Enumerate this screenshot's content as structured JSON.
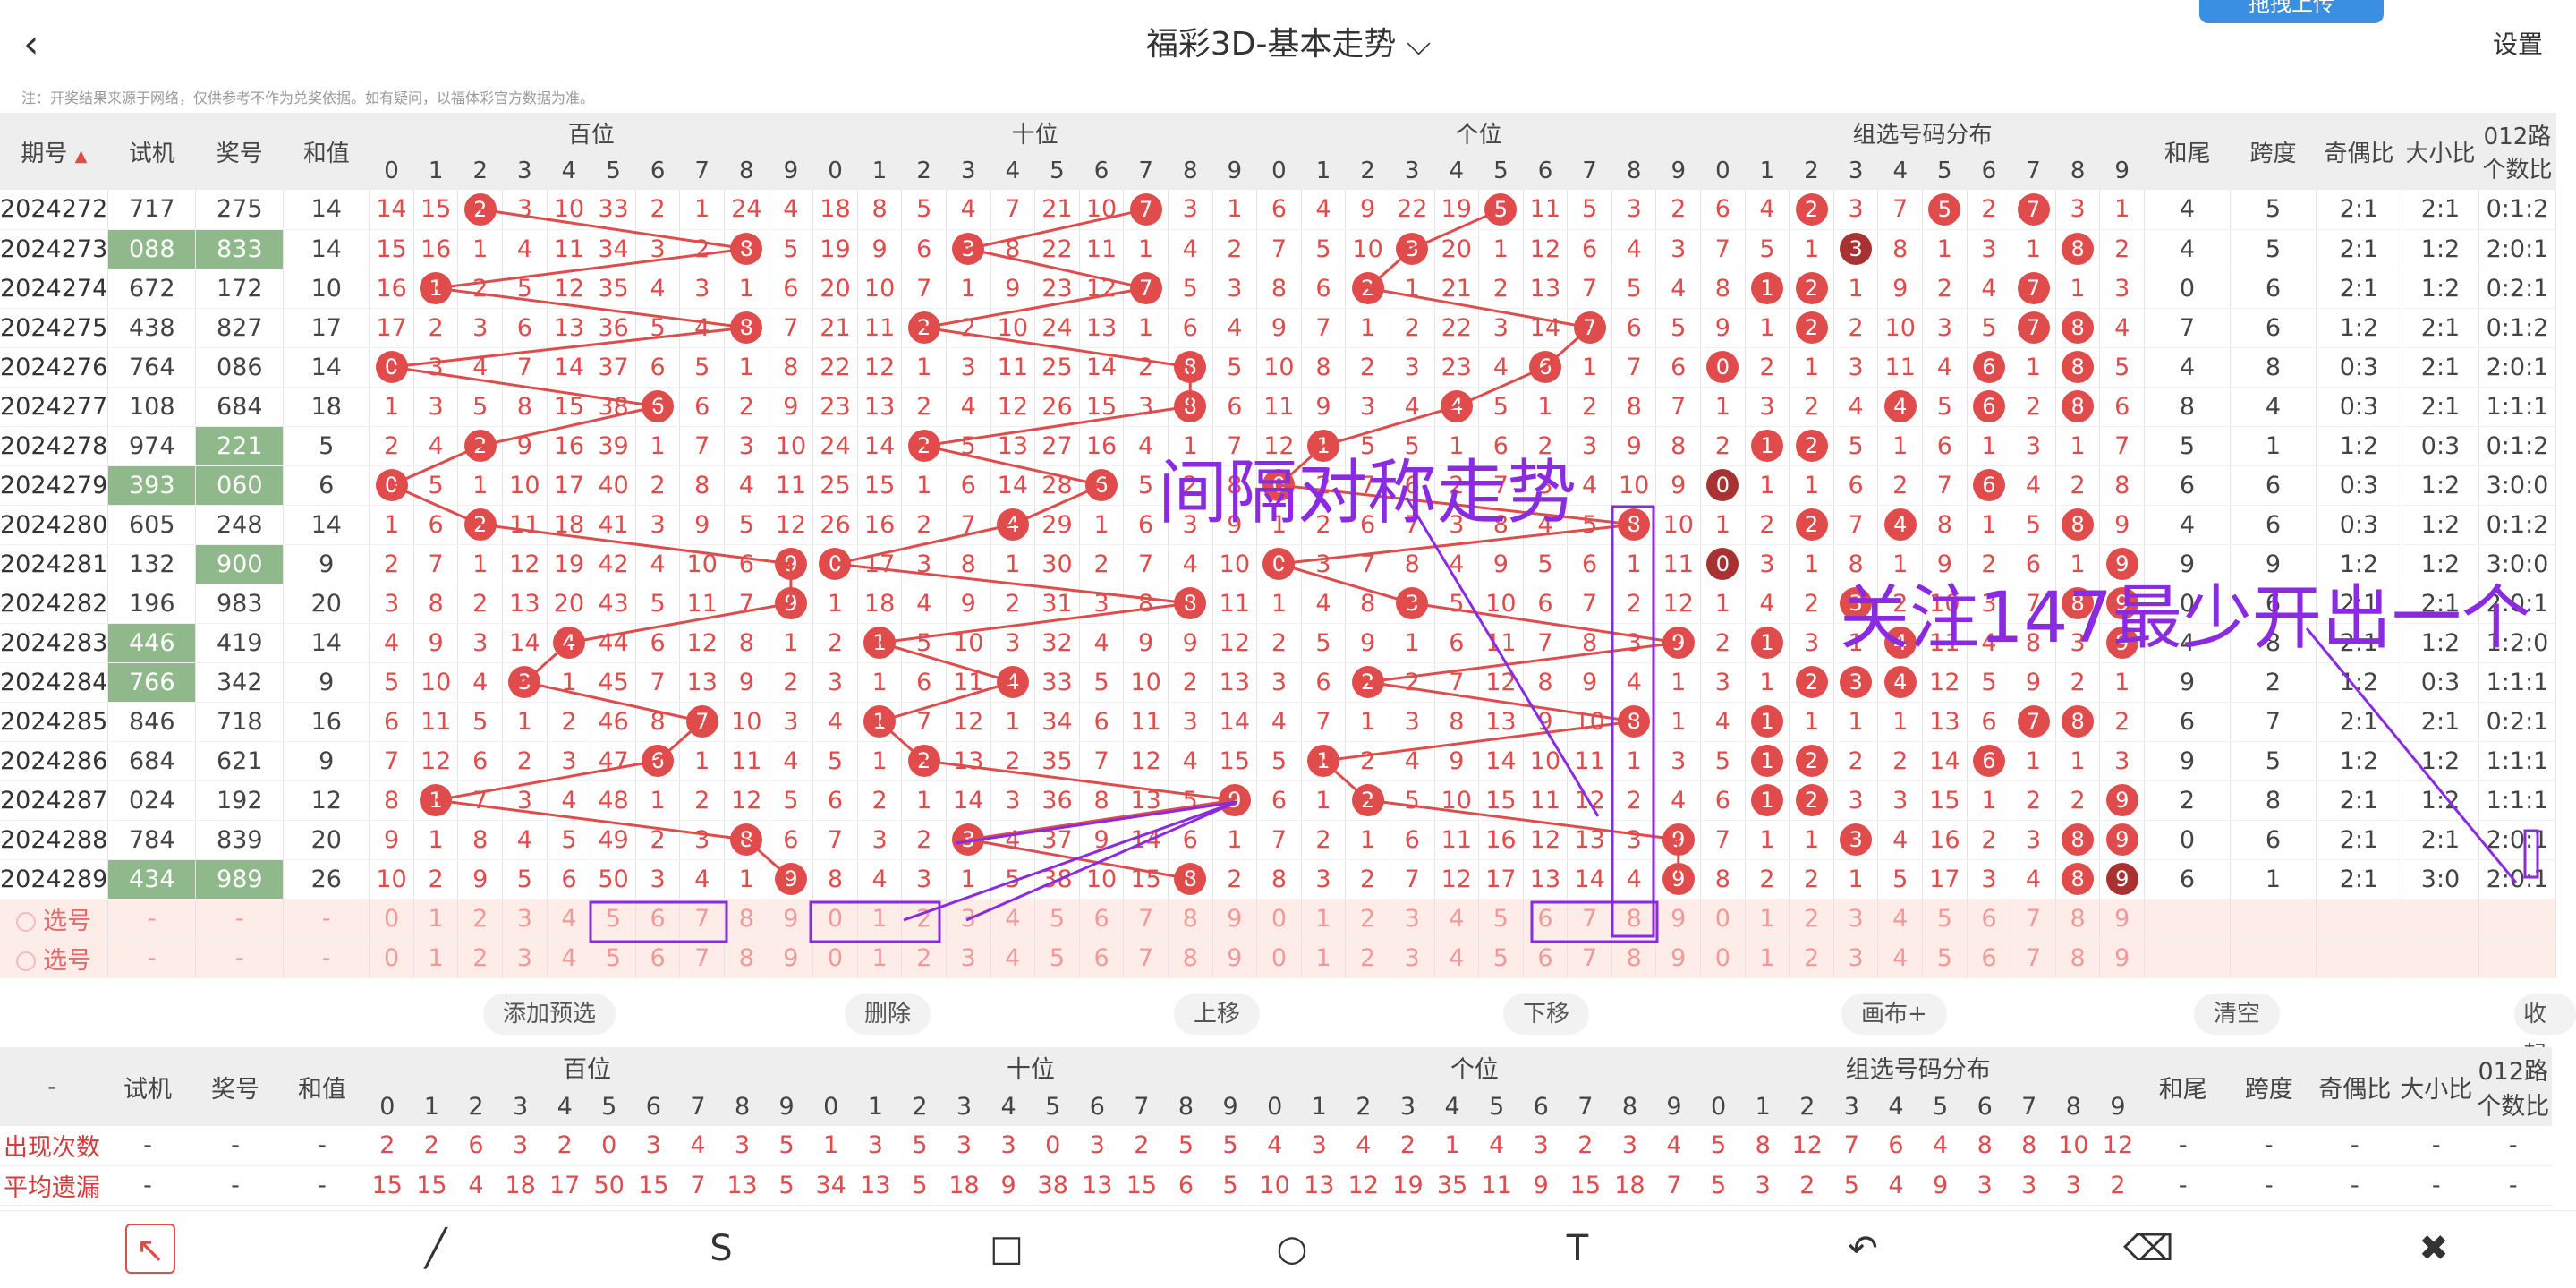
{
  "header": {
    "title": "福彩3D-基本走势",
    "settings": "设置",
    "upload": "拖拽上传"
  },
  "note": "注：开奖结果来源于网络，仅供参考不作为兑奖依据。如有疑问，以福体彩官方数据为准。",
  "columns": {
    "period": "期号",
    "test": "试机",
    "prize": "奖号",
    "sum": "和值",
    "hundreds": "百位",
    "tens": "十位",
    "units": "个位",
    "group": "组选号码分布",
    "sum_tail": "和尾",
    "span": "跨度",
    "odd_even": "奇偶比",
    "big_small": "大小比",
    "route012": "012路",
    "route012b": "个数比"
  },
  "digits": [
    "0",
    "1",
    "2",
    "3",
    "4",
    "5",
    "6",
    "7",
    "8",
    "9"
  ],
  "rows": [
    {
      "p": "2024272",
      "t": "717",
      "w": "275",
      "s": "14",
      "h": [
        "14",
        "15",
        "2",
        "3",
        "10",
        "33",
        "2",
        "1",
        "24",
        "4"
      ],
      "te": [
        "18",
        "8",
        "5",
        "4",
        "7",
        "21",
        "10",
        "7",
        "3",
        "1"
      ],
      "u": [
        "6",
        "4",
        "9",
        "22",
        "19",
        "5",
        "11",
        "5",
        "3",
        "2"
      ],
      "g": [
        "6",
        "4",
        "2",
        "3",
        "7",
        "5",
        "2",
        "7",
        "3",
        "1"
      ],
      "x": [
        "4",
        "5",
        "2:1",
        "2:1",
        "0:1:2"
      ]
    },
    {
      "p": "2024273",
      "t": "088",
      "w": "833",
      "s": "14",
      "h": [
        "15",
        "16",
        "1",
        "4",
        "11",
        "34",
        "3",
        "2",
        "8",
        "5"
      ],
      "te": [
        "19",
        "9",
        "6",
        "3",
        "8",
        "22",
        "11",
        "1",
        "4",
        "2"
      ],
      "u": [
        "7",
        "5",
        "10",
        "3",
        "20",
        "1",
        "12",
        "6",
        "4",
        "3"
      ],
      "g": [
        "7",
        "5",
        "1",
        "3",
        "8",
        "1",
        "3",
        "1",
        "8",
        "2"
      ],
      "x": [
        "4",
        "5",
        "2:1",
        "1:2",
        "2:0:1"
      ]
    },
    {
      "p": "2024274",
      "t": "672",
      "w": "172",
      "s": "10",
      "h": [
        "16",
        "1",
        "2",
        "5",
        "12",
        "35",
        "4",
        "3",
        "1",
        "6"
      ],
      "te": [
        "20",
        "10",
        "7",
        "1",
        "9",
        "23",
        "12",
        "7",
        "5",
        "3"
      ],
      "u": [
        "8",
        "6",
        "2",
        "1",
        "21",
        "2",
        "13",
        "7",
        "5",
        "4"
      ],
      "g": [
        "8",
        "1",
        "2",
        "1",
        "9",
        "2",
        "4",
        "7",
        "1",
        "3"
      ],
      "x": [
        "0",
        "6",
        "2:1",
        "1:2",
        "0:2:1"
      ]
    },
    {
      "p": "2024275",
      "t": "438",
      "w": "827",
      "s": "17",
      "h": [
        "17",
        "2",
        "3",
        "6",
        "13",
        "36",
        "5",
        "4",
        "8",
        "7"
      ],
      "te": [
        "21",
        "11",
        "2",
        "2",
        "10",
        "24",
        "13",
        "1",
        "6",
        "4"
      ],
      "u": [
        "9",
        "7",
        "1",
        "2",
        "22",
        "3",
        "14",
        "7",
        "6",
        "5"
      ],
      "g": [
        "9",
        "1",
        "2",
        "2",
        "10",
        "3",
        "5",
        "7",
        "8",
        "4"
      ],
      "x": [
        "7",
        "6",
        "1:2",
        "2:1",
        "0:1:2"
      ]
    },
    {
      "p": "2024276",
      "t": "764",
      "w": "086",
      "s": "14",
      "h": [
        "0",
        "3",
        "4",
        "7",
        "14",
        "37",
        "6",
        "5",
        "1",
        "8"
      ],
      "te": [
        "22",
        "12",
        "1",
        "3",
        "11",
        "25",
        "14",
        "2",
        "8",
        "5"
      ],
      "u": [
        "10",
        "8",
        "2",
        "3",
        "23",
        "4",
        "6",
        "1",
        "7",
        "6"
      ],
      "g": [
        "0",
        "2",
        "1",
        "3",
        "11",
        "4",
        "6",
        "1",
        "8",
        "5"
      ],
      "x": [
        "4",
        "8",
        "0:3",
        "2:1",
        "2:0:1"
      ]
    },
    {
      "p": "2024277",
      "t": "108",
      "w": "684",
      "s": "18",
      "h": [
        "1",
        "3",
        "5",
        "8",
        "15",
        "38",
        "6",
        "6",
        "2",
        "9"
      ],
      "te": [
        "23",
        "13",
        "2",
        "4",
        "12",
        "26",
        "15",
        "3",
        "8",
        "6"
      ],
      "u": [
        "11",
        "9",
        "3",
        "4",
        "4",
        "5",
        "1",
        "2",
        "8",
        "7"
      ],
      "g": [
        "1",
        "3",
        "2",
        "4",
        "4",
        "5",
        "6",
        "2",
        "8",
        "6"
      ],
      "x": [
        "8",
        "4",
        "0:3",
        "2:1",
        "1:1:1"
      ]
    },
    {
      "p": "2024278",
      "t": "974",
      "w": "221",
      "s": "5",
      "h": [
        "2",
        "4",
        "2",
        "9",
        "16",
        "39",
        "1",
        "7",
        "3",
        "10"
      ],
      "te": [
        "24",
        "14",
        "2",
        "5",
        "13",
        "27",
        "16",
        "4",
        "1",
        "7"
      ],
      "u": [
        "12",
        "1",
        "5",
        "5",
        "1",
        "6",
        "2",
        "3",
        "9",
        "8"
      ],
      "g": [
        "2",
        "1",
        "2",
        "5",
        "1",
        "6",
        "1",
        "3",
        "1",
        "7"
      ],
      "x": [
        "5",
        "1",
        "1:2",
        "0:3",
        "0:1:2"
      ]
    },
    {
      "p": "2024279",
      "t": "393",
      "w": "060",
      "s": "6",
      "h": [
        "0",
        "5",
        "1",
        "10",
        "17",
        "40",
        "2",
        "8",
        "4",
        "11"
      ],
      "te": [
        "25",
        "15",
        "1",
        "6",
        "14",
        "28",
        "6",
        "5",
        "2",
        "8"
      ],
      "u": [
        "0",
        "2",
        "7",
        "6",
        "2",
        "7",
        "3",
        "4",
        "10",
        "9"
      ],
      "g": [
        "0",
        "1",
        "1",
        "6",
        "2",
        "7",
        "6",
        "4",
        "2",
        "8"
      ],
      "x": [
        "6",
        "6",
        "0:3",
        "1:2",
        "3:0:0"
      ]
    },
    {
      "p": "2024280",
      "t": "605",
      "w": "248",
      "s": "14",
      "h": [
        "1",
        "6",
        "2",
        "11",
        "18",
        "41",
        "3",
        "9",
        "5",
        "12"
      ],
      "te": [
        "26",
        "16",
        "2",
        "7",
        "4",
        "29",
        "1",
        "6",
        "3",
        "9"
      ],
      "u": [
        "1",
        "2",
        "6",
        "7",
        "3",
        "8",
        "4",
        "5",
        "8",
        "10"
      ],
      "g": [
        "1",
        "2",
        "2",
        "7",
        "4",
        "8",
        "1",
        "5",
        "8",
        "9"
      ],
      "x": [
        "4",
        "6",
        "0:3",
        "1:2",
        "0:1:2"
      ]
    },
    {
      "p": "2024281",
      "t": "132",
      "w": "900",
      "s": "9",
      "h": [
        "2",
        "7",
        "1",
        "12",
        "19",
        "42",
        "4",
        "10",
        "6",
        "9"
      ],
      "te": [
        "0",
        "17",
        "3",
        "8",
        "1",
        "30",
        "2",
        "7",
        "4",
        "10"
      ],
      "u": [
        "0",
        "3",
        "7",
        "8",
        "4",
        "9",
        "5",
        "6",
        "1",
        "11"
      ],
      "g": [
        "0",
        "3",
        "1",
        "8",
        "1",
        "9",
        "2",
        "6",
        "1",
        "9"
      ],
      "x": [
        "9",
        "9",
        "1:2",
        "1:2",
        "3:0:0"
      ]
    },
    {
      "p": "2024282",
      "t": "196",
      "w": "983",
      "s": "20",
      "h": [
        "3",
        "8",
        "2",
        "13",
        "20",
        "43",
        "5",
        "11",
        "7",
        "9"
      ],
      "te": [
        "1",
        "18",
        "4",
        "9",
        "2",
        "31",
        "3",
        "8",
        "8",
        "11"
      ],
      "u": [
        "1",
        "4",
        "8",
        "3",
        "5",
        "10",
        "6",
        "7",
        "2",
        "12"
      ],
      "g": [
        "1",
        "4",
        "2",
        "3",
        "2",
        "10",
        "3",
        "7",
        "8",
        "9"
      ],
      "x": [
        "0",
        "6",
        "2:1",
        "2:1",
        "2:0:1"
      ]
    },
    {
      "p": "2024283",
      "t": "446",
      "w": "419",
      "s": "14",
      "h": [
        "4",
        "9",
        "3",
        "14",
        "4",
        "44",
        "6",
        "12",
        "8",
        "1"
      ],
      "te": [
        "2",
        "1",
        "5",
        "10",
        "3",
        "32",
        "4",
        "9",
        "9",
        "12"
      ],
      "u": [
        "2",
        "5",
        "9",
        "1",
        "6",
        "11",
        "7",
        "8",
        "3",
        "9"
      ],
      "g": [
        "2",
        "1",
        "3",
        "1",
        "4",
        "11",
        "4",
        "8",
        "3",
        "9"
      ],
      "x": [
        "4",
        "8",
        "2:1",
        "1:2",
        "1:2:0"
      ]
    },
    {
      "p": "2024284",
      "t": "766",
      "w": "342",
      "s": "9",
      "h": [
        "5",
        "10",
        "4",
        "3",
        "1",
        "45",
        "7",
        "13",
        "9",
        "2"
      ],
      "te": [
        "3",
        "1",
        "6",
        "11",
        "4",
        "33",
        "5",
        "10",
        "2",
        "13"
      ],
      "u": [
        "3",
        "6",
        "2",
        "2",
        "7",
        "12",
        "8",
        "9",
        "4",
        "1"
      ],
      "g": [
        "3",
        "1",
        "2",
        "3",
        "4",
        "12",
        "5",
        "9",
        "2",
        "1"
      ],
      "x": [
        "9",
        "2",
        "1:2",
        "0:3",
        "1:1:1"
      ]
    },
    {
      "p": "2024285",
      "t": "846",
      "w": "718",
      "s": "16",
      "h": [
        "6",
        "11",
        "5",
        "1",
        "2",
        "46",
        "8",
        "7",
        "10",
        "3"
      ],
      "te": [
        "4",
        "1",
        "7",
        "12",
        "1",
        "34",
        "6",
        "11",
        "3",
        "14"
      ],
      "u": [
        "4",
        "7",
        "1",
        "3",
        "8",
        "13",
        "9",
        "10",
        "8",
        "1"
      ],
      "g": [
        "4",
        "1",
        "1",
        "1",
        "1",
        "13",
        "6",
        "7",
        "8",
        "2"
      ],
      "x": [
        "6",
        "7",
        "2:1",
        "2:1",
        "0:2:1"
      ]
    },
    {
      "p": "2024286",
      "t": "684",
      "w": "621",
      "s": "9",
      "h": [
        "7",
        "12",
        "6",
        "2",
        "3",
        "47",
        "6",
        "1",
        "11",
        "4"
      ],
      "te": [
        "5",
        "1",
        "2",
        "13",
        "2",
        "35",
        "7",
        "12",
        "4",
        "15"
      ],
      "u": [
        "5",
        "1",
        "2",
        "4",
        "9",
        "14",
        "10",
        "11",
        "1",
        "3"
      ],
      "g": [
        "5",
        "1",
        "2",
        "2",
        "2",
        "14",
        "6",
        "1",
        "1",
        "3"
      ],
      "x": [
        "9",
        "5",
        "1:2",
        "1:2",
        "1:1:1"
      ]
    },
    {
      "p": "2024287",
      "t": "024",
      "w": "192",
      "s": "12",
      "h": [
        "8",
        "1",
        "7",
        "3",
        "4",
        "48",
        "1",
        "2",
        "12",
        "5"
      ],
      "te": [
        "6",
        "2",
        "1",
        "14",
        "3",
        "36",
        "8",
        "13",
        "5",
        "9"
      ],
      "u": [
        "6",
        "1",
        "2",
        "5",
        "10",
        "15",
        "11",
        "12",
        "2",
        "4"
      ],
      "g": [
        "6",
        "1",
        "2",
        "3",
        "3",
        "15",
        "1",
        "2",
        "2",
        "9"
      ],
      "x": [
        "2",
        "8",
        "2:1",
        "1:2",
        "1:1:1"
      ]
    },
    {
      "p": "2024288",
      "t": "784",
      "w": "839",
      "s": "20",
      "h": [
        "9",
        "1",
        "8",
        "4",
        "5",
        "49",
        "2",
        "3",
        "8",
        "6"
      ],
      "te": [
        "7",
        "3",
        "2",
        "3",
        "4",
        "37",
        "9",
        "14",
        "6",
        "1"
      ],
      "u": [
        "7",
        "2",
        "1",
        "6",
        "11",
        "16",
        "12",
        "13",
        "3",
        "9"
      ],
      "g": [
        "7",
        "1",
        "1",
        "3",
        "4",
        "16",
        "2",
        "3",
        "8",
        "9"
      ],
      "x": [
        "0",
        "6",
        "2:1",
        "2:1",
        "2:0:1"
      ]
    },
    {
      "p": "2024289",
      "t": "434",
      "w": "989",
      "s": "26",
      "h": [
        "10",
        "2",
        "9",
        "5",
        "6",
        "50",
        "3",
        "4",
        "1",
        "9"
      ],
      "te": [
        "8",
        "4",
        "3",
        "1",
        "5",
        "38",
        "10",
        "15",
        "8",
        "2"
      ],
      "u": [
        "8",
        "3",
        "2",
        "7",
        "12",
        "17",
        "13",
        "14",
        "4",
        "9"
      ],
      "g": [
        "8",
        "2",
        "2",
        "1",
        "5",
        "17",
        "3",
        "4",
        "8",
        "9"
      ],
      "x": [
        "6",
        "1",
        "2:1",
        "3:0",
        "2:0:1"
      ]
    }
  ],
  "pick_rows": [
    {
      "label": "选号",
      "dash": "-"
    },
    {
      "label": "选号",
      "dash": "-"
    }
  ],
  "buttons": {
    "add": "添加预选",
    "delete": "删除",
    "up": "上移",
    "down": "下移",
    "canvas": "画布+",
    "clear": "清空",
    "collapse": "收起"
  },
  "stats": {
    "corner": "-",
    "labels": [
      "出现次数",
      "平均遗漏"
    ],
    "appear": {
      "h": [
        "2",
        "2",
        "6",
        "3",
        "2",
        "0",
        "3",
        "4",
        "3",
        "5"
      ],
      "te": [
        "1",
        "3",
        "5",
        "3",
        "3",
        "0",
        "3",
        "2",
        "5",
        "5"
      ],
      "u": [
        "4",
        "3",
        "4",
        "2",
        "1",
        "4",
        "3",
        "2",
        "3",
        "4"
      ],
      "g": [
        "5",
        "8",
        "12",
        "7",
        "6",
        "4",
        "8",
        "8",
        "10",
        "12"
      ]
    },
    "miss": {
      "h": [
        "15",
        "15",
        "4",
        "18",
        "17",
        "50",
        "15",
        "7",
        "13",
        "5"
      ],
      "te": [
        "34",
        "13",
        "5",
        "18",
        "9",
        "38",
        "13",
        "15",
        "6",
        "5"
      ],
      "u": [
        "10",
        "13",
        "12",
        "19",
        "35",
        "11",
        "9",
        "15",
        "18",
        "7"
      ],
      "g": [
        "5",
        "3",
        "2",
        "5",
        "4",
        "9",
        "3",
        "3",
        "3",
        "2"
      ]
    }
  },
  "annotations": {
    "a1": "间隔对称走势",
    "a2": "关注147最少开出一个"
  },
  "colors": {
    "ball": "#e04c4c",
    "ball_dark": "#a83232",
    "highlight": "#8fb98a",
    "annotation": "#8a2be2"
  },
  "draw_tools": [
    "pointer-icon",
    "line-icon",
    "curve-icon",
    "rectangle-icon",
    "circle-icon",
    "text-icon",
    "undo-icon",
    "eraser-icon",
    "clear-icon"
  ]
}
